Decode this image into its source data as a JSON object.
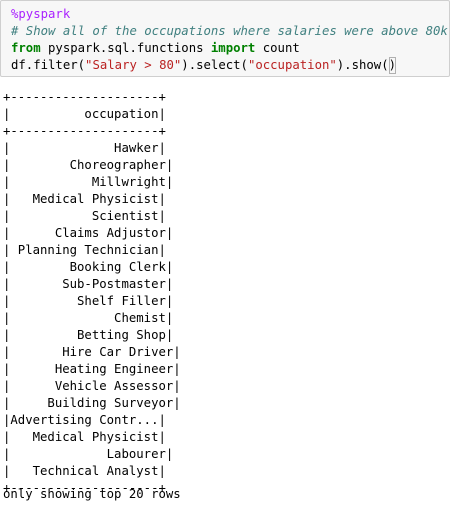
{
  "input_cell": {
    "magic": "%pyspark",
    "comment": "# Show all of the occupations where salaries were above 80k",
    "import_from": "from",
    "import_module": " pyspark.sql.functions ",
    "import_keyword": "import",
    "import_name": " count",
    "call_prefix": "df.filter(",
    "filter_arg": "\"Salary > 80\"",
    "call_middle": ").select(",
    "select_arg": "\"occupation\"",
    "call_show": ").show(",
    "call_end": ")"
  },
  "output": {
    "table_lines": [
      "+--------------------+",
      "|          occupation|",
      "+--------------------+",
      "|              Hawker|",
      "|        Choreographer|",
      "|           Millwright|",
      "|   Medical Physicist|",
      "|           Scientist|",
      "|      Claims Adjustor|",
      "| Planning Technician|",
      "|        Booking Clerk|",
      "|       Sub-Postmaster|",
      "|         Shelf Filler|",
      "|              Chemist|",
      "|         Betting Shop|",
      "|       Hire Car Driver|",
      "|      Heating Engineer|",
      "|      Vehicle Assessor|",
      "|     Building Surveyor|",
      "|Advertising Contr...|",
      "|   Medical Physicist|",
      "|             Labourer|",
      "|   Technical Analyst|",
      "+--------------------+"
    ],
    "footer": "only showing top 20 rows"
  }
}
